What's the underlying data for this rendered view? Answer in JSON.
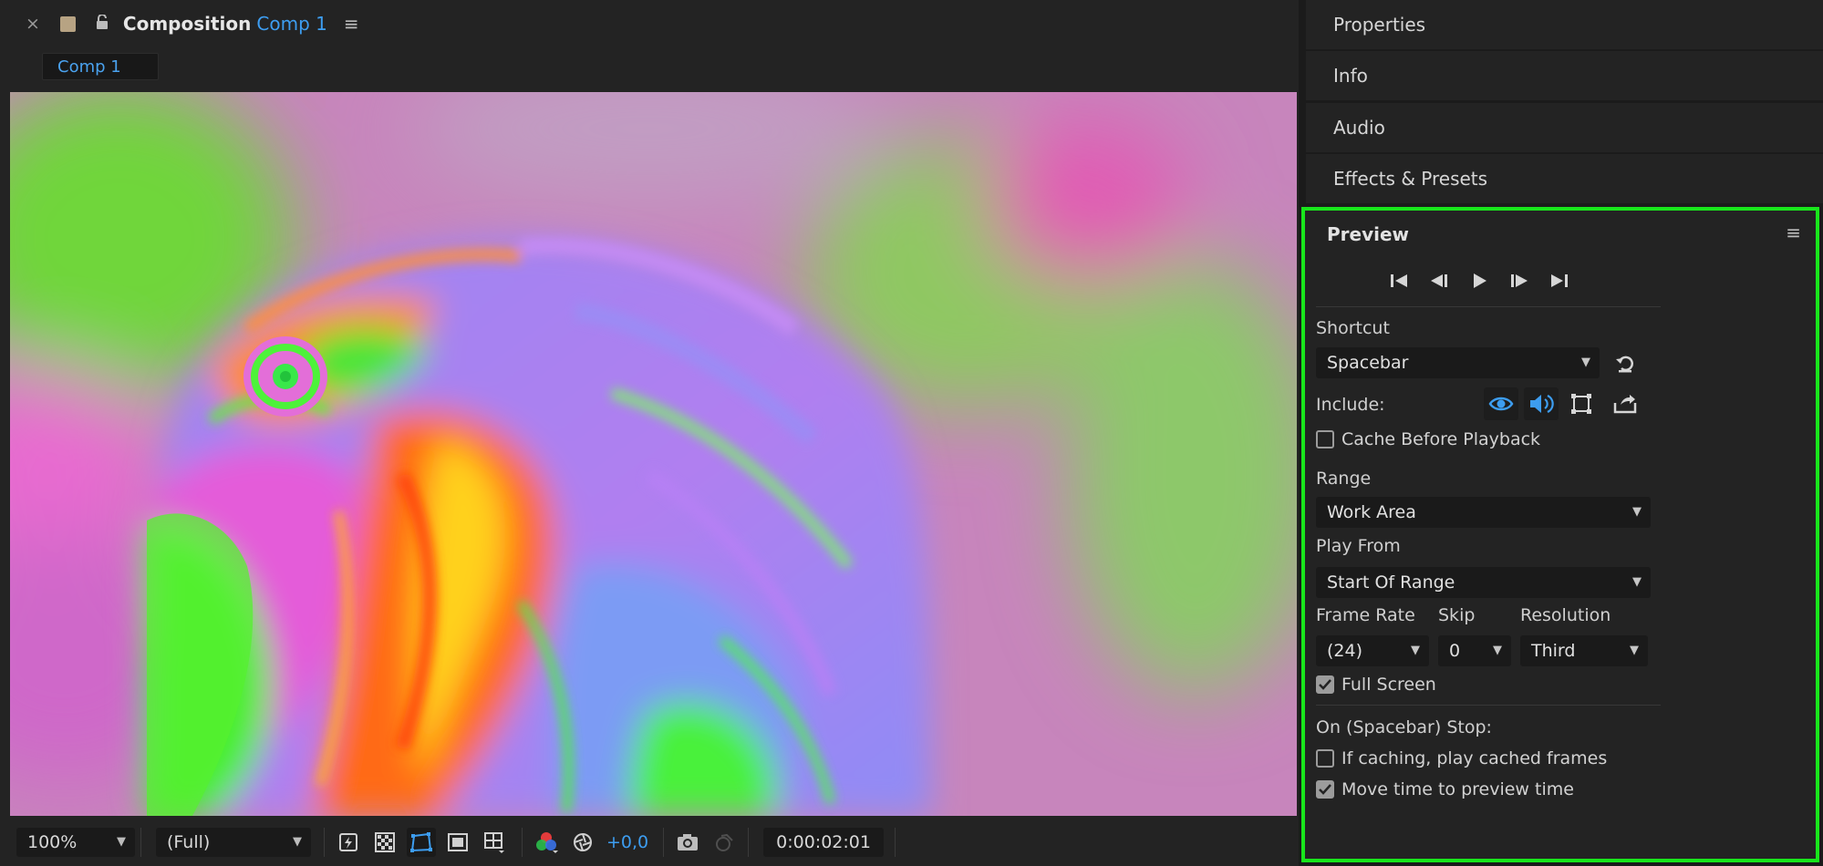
{
  "composition": {
    "close_glyph": "×",
    "panel_label": "Composition",
    "comp_name": "Comp 1",
    "menu_glyph": "≡",
    "tab_label": "Comp 1"
  },
  "toolbar": {
    "zoom": "100%",
    "resolution": "(Full)",
    "exposure": "+0,0",
    "timecode": "0:00:02:01"
  },
  "right_panels": {
    "properties": "Properties",
    "info": "Info",
    "audio": "Audio",
    "effects": "Effects & Presets"
  },
  "preview": {
    "title": "Preview",
    "menu_glyph": "≡",
    "shortcut_label": "Shortcut",
    "shortcut_value": "Spacebar",
    "include_label": "Include:",
    "cache_before_playback": {
      "label": "Cache Before Playback",
      "checked": false
    },
    "range_label": "Range",
    "range_value": "Work Area",
    "play_from_label": "Play From",
    "play_from_value": "Start Of Range",
    "frame_rate_label": "Frame Rate",
    "skip_label": "Skip",
    "resolution_label": "Resolution",
    "frame_rate_value": "(24)",
    "skip_value": "0",
    "resolution_value": "Third",
    "full_screen": {
      "label": "Full Screen",
      "checked": true
    },
    "on_stop_label": "On (Spacebar) Stop:",
    "if_caching": {
      "label": "If caching, play cached frames",
      "checked": false
    },
    "move_time": {
      "label": "Move time to preview time",
      "checked": true
    }
  },
  "colors": {
    "accent_blue": "#3d9df0",
    "highlight_green": "#19e61c"
  },
  "icons": {
    "include_video": "eye-icon",
    "include_audio": "speaker-icon",
    "include_overlays": "overlay-frame-icon"
  }
}
